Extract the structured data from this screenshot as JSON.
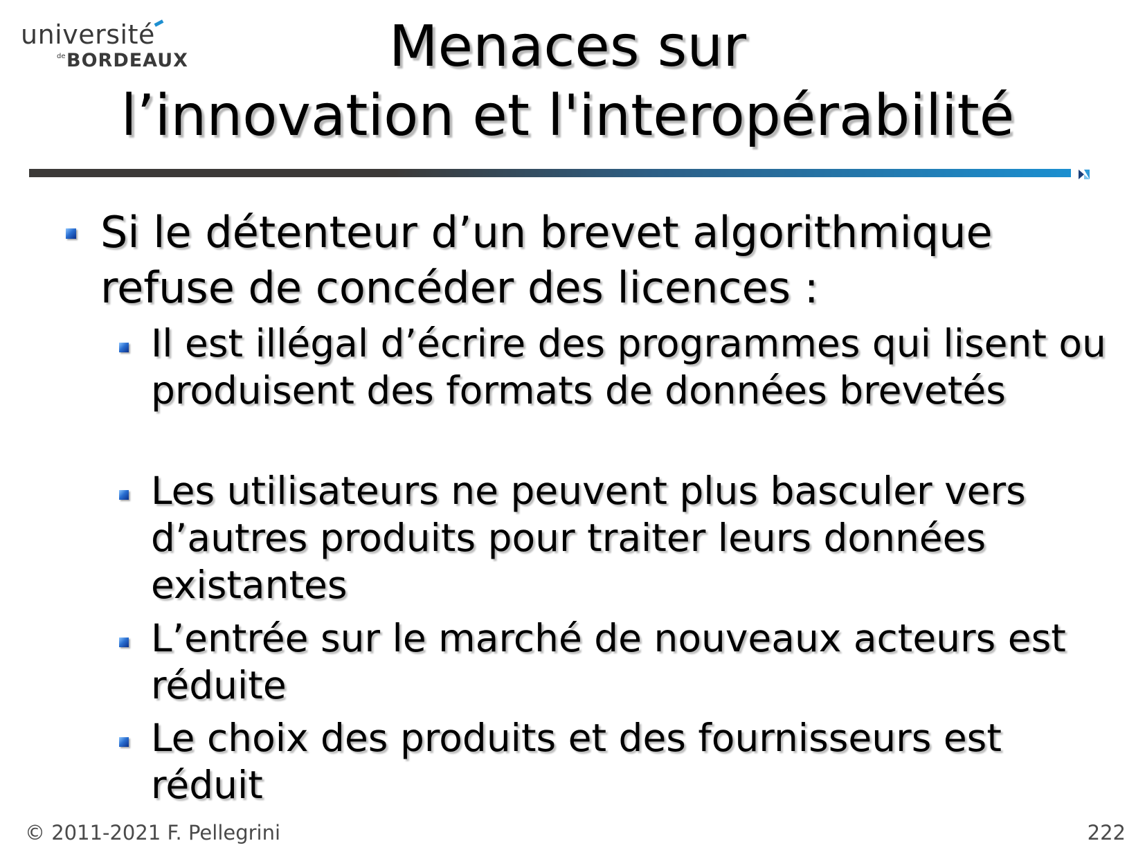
{
  "logo": {
    "line1": "université",
    "de": "de",
    "line2": "BORDEAUX"
  },
  "title": {
    "line1": "Menaces sur",
    "line2": "l’innovation et l'interopérabilité"
  },
  "main_bullet": {
    "text": "Si le détenteur d’un brevet algorithmique refuse de concéder des licences :"
  },
  "sub_bullets": [
    {
      "text": "Il est illégal d’écrire des programmes qui lisent ou produisent des formats de données brevetés"
    },
    {
      "text": "Les utilisateurs ne peuvent plus basculer vers d’autres produits pour traiter leurs données existantes"
    },
    {
      "text": "L’entrée sur le marché de nouveaux acteurs est réduite"
    },
    {
      "text": "Le choix des produits et des fournisseurs est réduit"
    }
  ],
  "footer": {
    "copyright": "© 2011-2021 F. Pellegrini",
    "page_number": "222"
  },
  "colors": {
    "accent_blue": "#1b8fd0",
    "bar_dark": "#3c3a38",
    "footer_text": "#4a4a4a"
  }
}
